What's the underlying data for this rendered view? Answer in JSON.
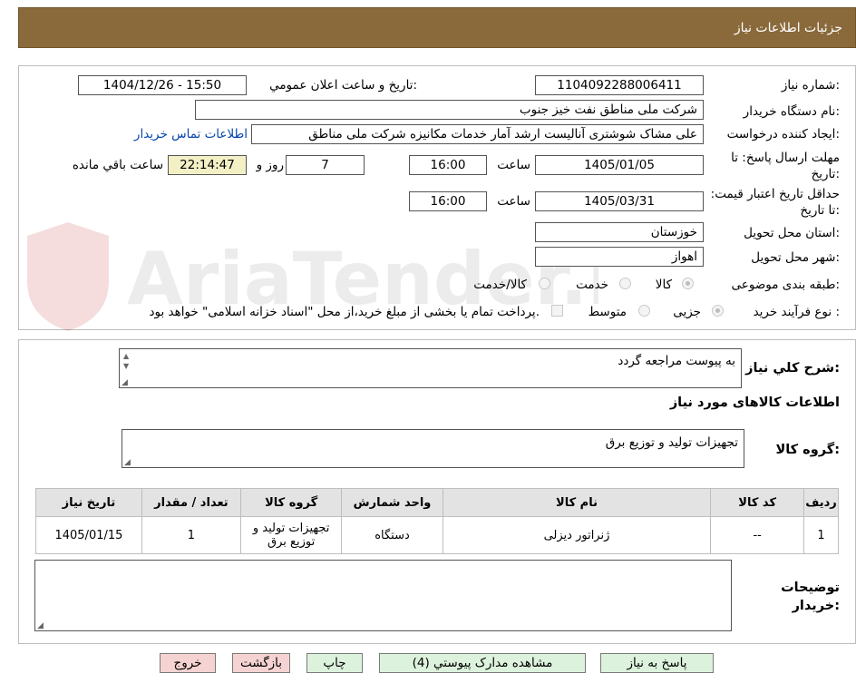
{
  "header": {
    "title": "جزئیات اطلاعات نیاز"
  },
  "watermark": {
    "brand_text": "AriaTender.neT"
  },
  "form": {
    "need_number_label": "شماره نیاز:",
    "need_number": "1104092288006411",
    "announce_label": "تاریخ و ساعت اعلان عمومي:",
    "announce_value": "1404/12/26 - 15:50",
    "buyer_label": "نام دستگاه خریدار:",
    "buyer_value": "شرکت ملی مناطق نفت خیز جنوب",
    "creator_label": "ایجاد کننده درخواست:",
    "creator_value": "علی  مشاک شوشتری  آنالیست ارشد آمار خدمات مکانیزه شرکت ملی مناطق",
    "contact_link": "اطلاعات تماس خریدار",
    "deadline_label": "مهلت ارسال پاسخ: تا تاریخ:",
    "deadline_date": "1405/01/05",
    "time_label": "ساعت",
    "deadline_time": "16:00",
    "days_value": "7",
    "days_label": "روز و",
    "remaining_time": "22:14:47",
    "remaining_label": "ساعت باقي مانده",
    "validity_label": "حداقل تاریخ اعتبار قیمت: تا تاریخ:",
    "validity_date": "1405/03/31",
    "validity_time": "16:00",
    "province_label": "استان محل تحویل:",
    "province_value": "خوزستان",
    "city_label": "شهر محل تحویل:",
    "city_value": "اهواز",
    "category_label": "طبقه بندی موضوعی:",
    "category_options": [
      "کالا",
      "خدمت",
      "کالا/خدمت"
    ],
    "category_selected": "کالا",
    "process_label": "نوع فرآیند خرید :",
    "process_options": [
      "جزیی",
      "متوسط"
    ],
    "process_selected": "جزیی",
    "payment_note": "پرداخت تمام یا بخشی از مبلغ خرید،از محل \"اسناد خزانه اسلامی\" خواهد بود."
  },
  "description": {
    "label": "شرح كلي نياز:",
    "value": "به پیوست مراجعه گردد",
    "goods_info_title": "اطلاعات کالاهای مورد نیاز",
    "group_label": "گروه کالا:",
    "group_value": "تجهیزات تولید و توزیع برق"
  },
  "table": {
    "headers": [
      "ردیف",
      "کد کالا",
      "نام کالا",
      "واحد شمارش",
      "گروه کالا",
      "تعداد / مقدار",
      "تاریخ نیاز"
    ],
    "rows": [
      [
        "1",
        "--",
        "ژنراتور دیزلی",
        "دستگاه",
        "تجهیزات تولید و توزیع برق",
        "1",
        "1405/01/15"
      ]
    ]
  },
  "buyer_notes": {
    "label": "توضیحات خریدار:",
    "value": ""
  },
  "buttons": {
    "reply": "پاسخ به نیاز",
    "docs": "مشاهده مدارک پیوستي (4)",
    "print": "چاپ",
    "back": "بازگشت",
    "exit": "خروج"
  },
  "colors": {
    "header_bg": "#8a6a3b",
    "green_button": "#ddf2dd",
    "red_button": "#f6d3d3",
    "remaining_bg": "#f3f0c6"
  }
}
